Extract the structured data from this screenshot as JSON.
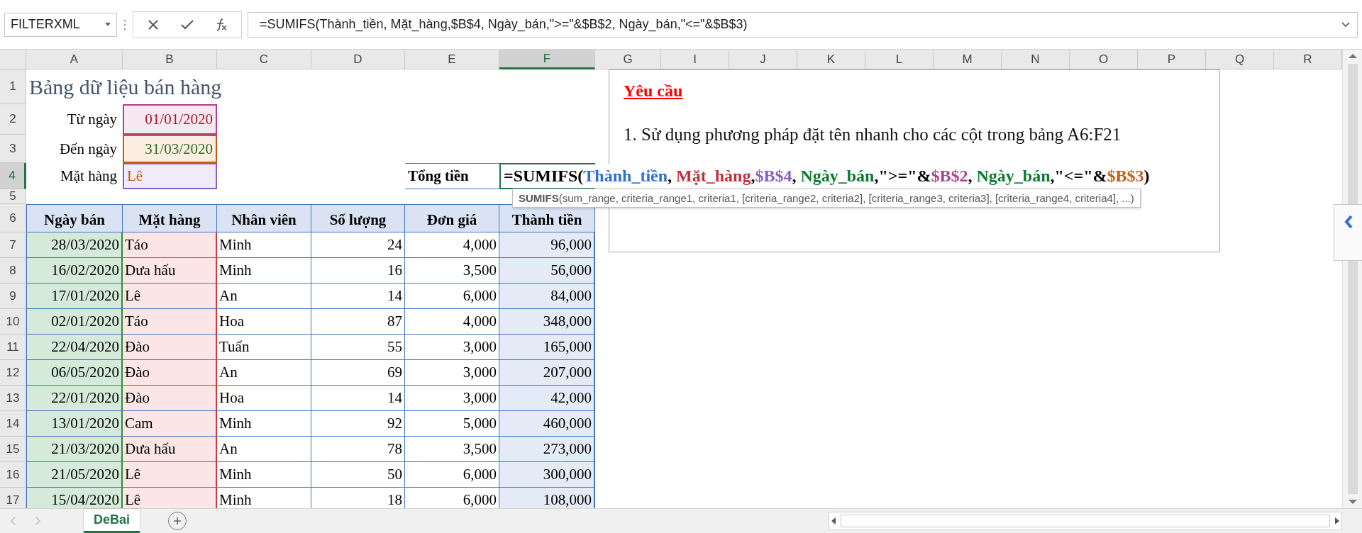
{
  "formula_bar": {
    "name_box": "FILTERXML",
    "formula": "=SUMIFS(Thành_tiền, Mặt_hàng,$B$4, Ngày_bán,\">=\"&$B$2, Ngày_bán,\"<=\"&$B$3)"
  },
  "column_headers": [
    {
      "label": "A",
      "selected": false
    },
    {
      "label": "B",
      "selected": false
    },
    {
      "label": "C",
      "selected": false
    },
    {
      "label": "D",
      "selected": false
    },
    {
      "label": "E",
      "selected": false
    },
    {
      "label": "F",
      "selected": true
    },
    {
      "label": "G",
      "selected": false
    },
    {
      "label": "I",
      "selected": false
    },
    {
      "label": "J",
      "selected": false
    },
    {
      "label": "K",
      "selected": false
    },
    {
      "label": "L",
      "selected": false
    },
    {
      "label": "M",
      "selected": false
    },
    {
      "label": "N",
      "selected": false
    },
    {
      "label": "O",
      "selected": false
    },
    {
      "label": "P",
      "selected": false
    },
    {
      "label": "Q",
      "selected": false
    },
    {
      "label": "R",
      "selected": false
    }
  ],
  "row_headers": [
    {
      "label": "1",
      "selected": false
    },
    {
      "label": "2",
      "selected": false
    },
    {
      "label": "3",
      "selected": false
    },
    {
      "label": "4",
      "selected": true
    },
    {
      "label": "5",
      "selected": false
    },
    {
      "label": "6",
      "selected": false
    },
    {
      "label": "7",
      "selected": false
    },
    {
      "label": "8",
      "selected": false
    },
    {
      "label": "9",
      "selected": false
    },
    {
      "label": "10",
      "selected": false
    },
    {
      "label": "11",
      "selected": false
    },
    {
      "label": "12",
      "selected": false
    },
    {
      "label": "13",
      "selected": false
    },
    {
      "label": "14",
      "selected": false
    },
    {
      "label": "15",
      "selected": false
    },
    {
      "label": "16",
      "selected": false
    },
    {
      "label": "17",
      "selected": false
    }
  ],
  "title": "Bảng dữ liệu bán hàng",
  "criteria": [
    {
      "label": "Từ ngày",
      "value": "01/01/2020",
      "color": "#b0408f"
    },
    {
      "label": "Đến ngày",
      "value": "31/03/2020",
      "color": "#c55a11"
    },
    {
      "label": "Mặt hàng",
      "value": "Lê",
      "color": "#8b5cc4"
    }
  ],
  "total": {
    "label": "Tổng tiền",
    "formula_parts": [
      {
        "text": "=SUMIFS(",
        "color": "#000000"
      },
      {
        "text": "Thành_tiền",
        "color": "#2e6fd0"
      },
      {
        "text": ", ",
        "color": "#000000"
      },
      {
        "text": "Mặt_hàng",
        "color": "#c0303a"
      },
      {
        "text": ",",
        "color": "#000000"
      },
      {
        "text": "$B$4",
        "color": "#8b5cc4"
      },
      {
        "text": ", ",
        "color": "#000000"
      },
      {
        "text": "Ngày_bán",
        "color": "#0b7a2e"
      },
      {
        "text": ",\">=\"&",
        "color": "#000000"
      },
      {
        "text": "$B$2",
        "color": "#b0408f"
      },
      {
        "text": ", ",
        "color": "#000000"
      },
      {
        "text": "Ngày_bán",
        "color": "#0b7a2e"
      },
      {
        "text": ",\"<=\"&",
        "color": "#000000"
      },
      {
        "text": "$B$3",
        "color": "#c55a11"
      },
      {
        "text": ")",
        "color": "#000000"
      }
    ]
  },
  "tooltip": "**SUMIFS**(sum_range, criteria_range1, criteria1, [criteria_range2, criteria2], [criteria_range3, criteria3], [criteria_range4, criteria4], ...)",
  "table": {
    "columns": [
      "Ngày bán",
      "Mặt hàng",
      "Nhân viên",
      "Số lượng",
      "Đơn giá",
      "Thành tiền"
    ],
    "rows": [
      [
        "28/03/2020",
        "Táo",
        "Minh",
        "24",
        "4,000",
        "96,000"
      ],
      [
        "16/02/2020",
        "Dưa hấu",
        "Minh",
        "16",
        "3,500",
        "56,000"
      ],
      [
        "17/01/2020",
        "Lê",
        "An",
        "14",
        "6,000",
        "84,000"
      ],
      [
        "02/01/2020",
        "Táo",
        "Hoa",
        "87",
        "4,000",
        "348,000"
      ],
      [
        "22/04/2020",
        "Đào",
        "Tuấn",
        "55",
        "3,000",
        "165,000"
      ],
      [
        "06/05/2020",
        "Đào",
        "An",
        "69",
        "3,000",
        "207,000"
      ],
      [
        "22/01/2020",
        "Đào",
        "Hoa",
        "14",
        "3,000",
        "42,000"
      ],
      [
        "13/01/2020",
        "Cam",
        "Minh",
        "92",
        "5,000",
        "460,000"
      ],
      [
        "21/03/2020",
        "Dưa hấu",
        "An",
        "78",
        "3,500",
        "273,000"
      ],
      [
        "21/05/2020",
        "Lê",
        "Minh",
        "50",
        "6,000",
        "300,000"
      ],
      [
        "15/04/2020",
        "Lê",
        "Minh",
        "18",
        "6,000",
        "108,000"
      ]
    ]
  },
  "note": {
    "title": "Yêu cầu",
    "items": [
      "1. Sử dụng phương pháp đặt tên nhanh cho các cột trong bảng A6:F21"
    ]
  },
  "sheet_tabs": [
    {
      "label": "DeBai",
      "selected": true
    }
  ]
}
